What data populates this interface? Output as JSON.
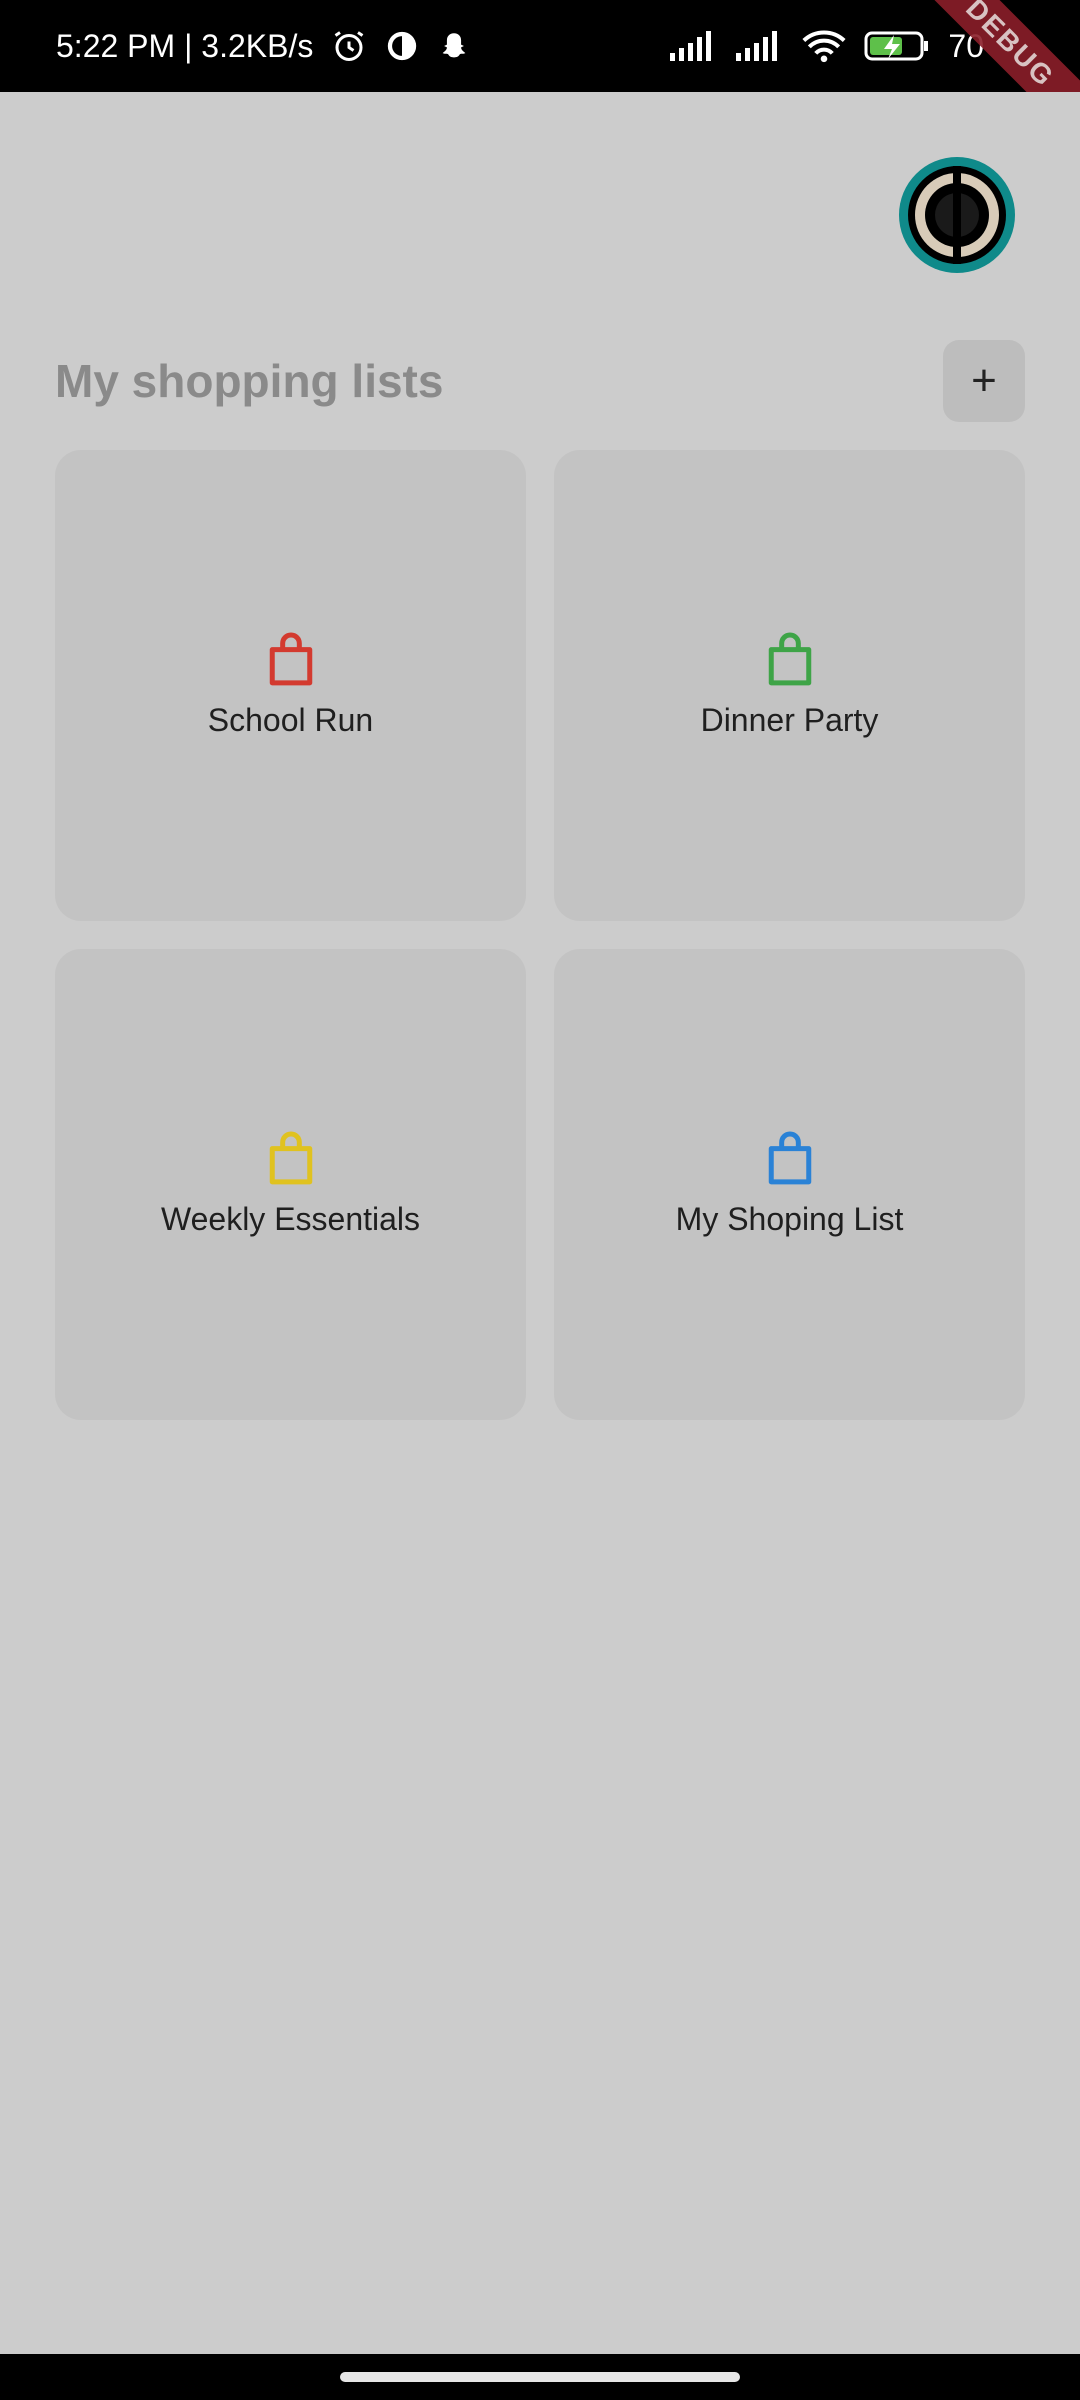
{
  "status_bar": {
    "time_speed": "5:22 PM | 3.2KB/s",
    "battery": "70",
    "debug_label": "DEBUG"
  },
  "header": {
    "title": "My shopping lists",
    "add_label": "+"
  },
  "lists": [
    {
      "label": "School Run",
      "color": "#d33a2f"
    },
    {
      "label": "Dinner Party",
      "color": "#3ea447"
    },
    {
      "label": "Weekly Essentials",
      "color": "#e0c21f"
    },
    {
      "label": "My Shoping List",
      "color": "#2a82d6"
    }
  ],
  "icons": {
    "list_icon": "shopping-bag-icon",
    "avatar": "target-logo-icon"
  }
}
